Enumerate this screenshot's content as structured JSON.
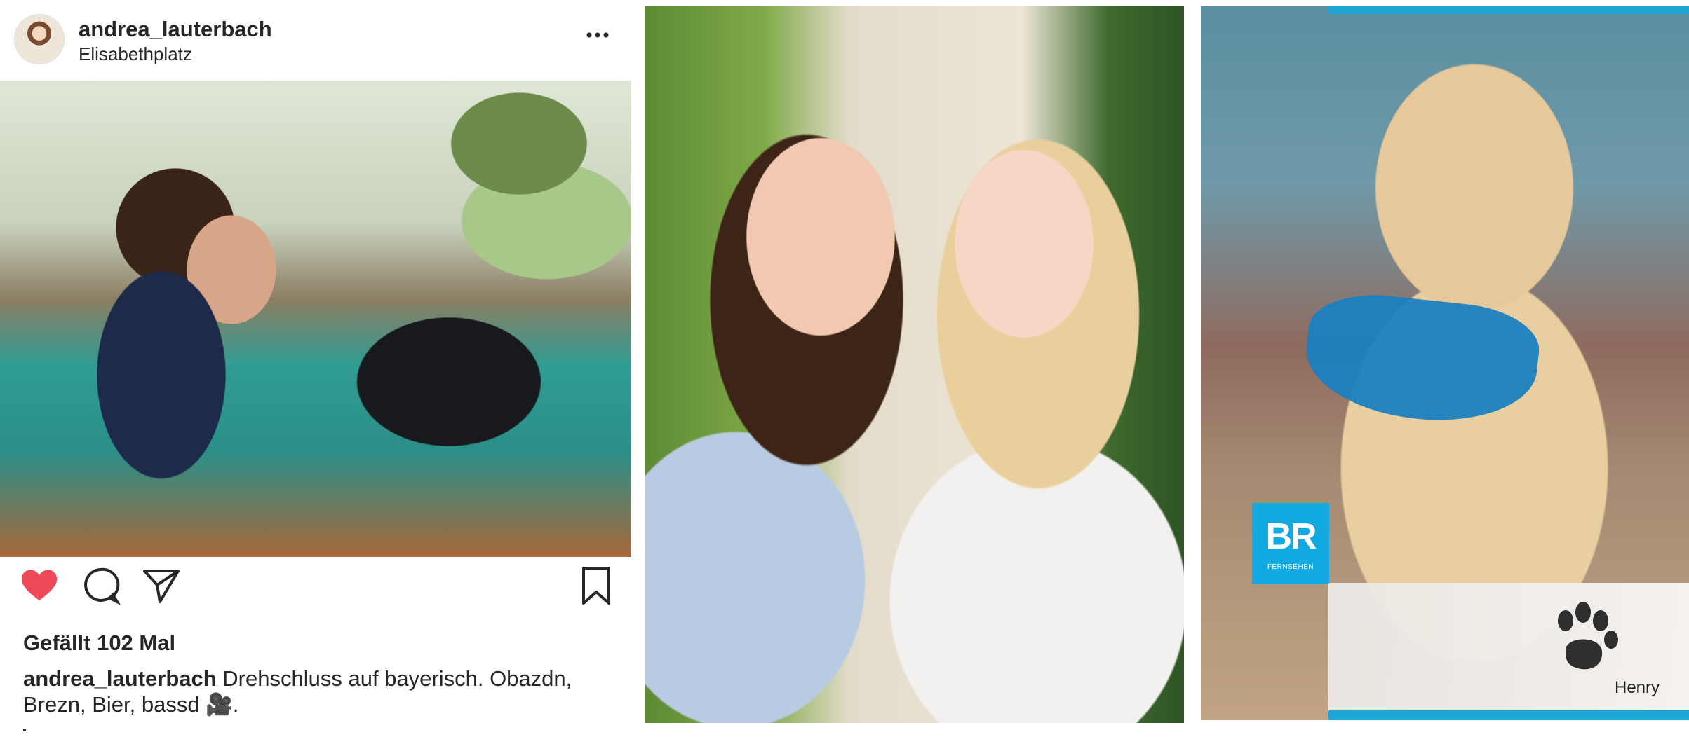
{
  "post": {
    "username": "andrea_lauterbach",
    "location": "Elisabethplatz",
    "more_label": "•••",
    "likes_text": "Gefällt 102 Mal",
    "caption_user": "andrea_lauterbach",
    "caption_text": " Drehschluss auf bayerisch. Obazdn, Brezn, Bier, bassd 🎥.",
    "colors": {
      "like": "#ed4956",
      "text": "#262626"
    }
  },
  "dog_card": {
    "logo_letters": "BR",
    "logo_subtitle": "FERNSEHEN",
    "name": "Henry",
    "colors": {
      "brand": "#1ea6d9"
    }
  }
}
